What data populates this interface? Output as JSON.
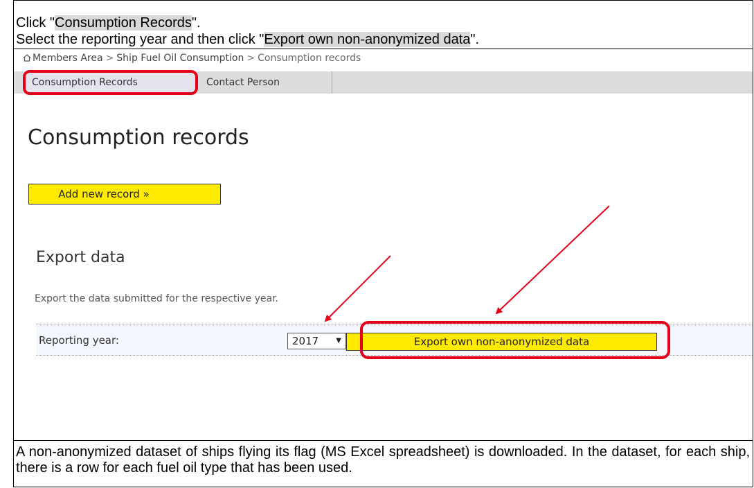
{
  "instructions": {
    "line1_prefix": "Click \"",
    "line1_highlight": "Consumption Records",
    "line1_suffix": "\".",
    "line2_prefix": "Select the reporting year and then click \"",
    "line2_highlight": "Export own non-anonymized data",
    "line2_suffix": "\"."
  },
  "breadcrumb": {
    "items": [
      "Members Area",
      "Ship Fuel Oil Consumption",
      "Consumption records"
    ],
    "separator": ">"
  },
  "tabs": [
    {
      "label": "Consumption Records",
      "active": true
    },
    {
      "label": "Contact Person",
      "active": false
    }
  ],
  "page": {
    "title": "Consumption records",
    "add_button_label": "Add new record »"
  },
  "export": {
    "title": "Export data",
    "description": "Export the data submitted for the respective year.",
    "year_label": "Reporting year:",
    "selected_year": "2017",
    "button_label": "Export own non-anonymized data"
  },
  "footnote": "A non-anonymized dataset of ships flying its flag (MS Excel spreadsheet) is downloaded. In the dataset, for each ship, there is a row for each fuel oil type that has been used.",
  "colors": {
    "button_yellow": "#ffeb00",
    "callout_red": "#e5001a",
    "highlight_gray": "#d9d9d9",
    "active_tab": "#e4e4ef"
  }
}
